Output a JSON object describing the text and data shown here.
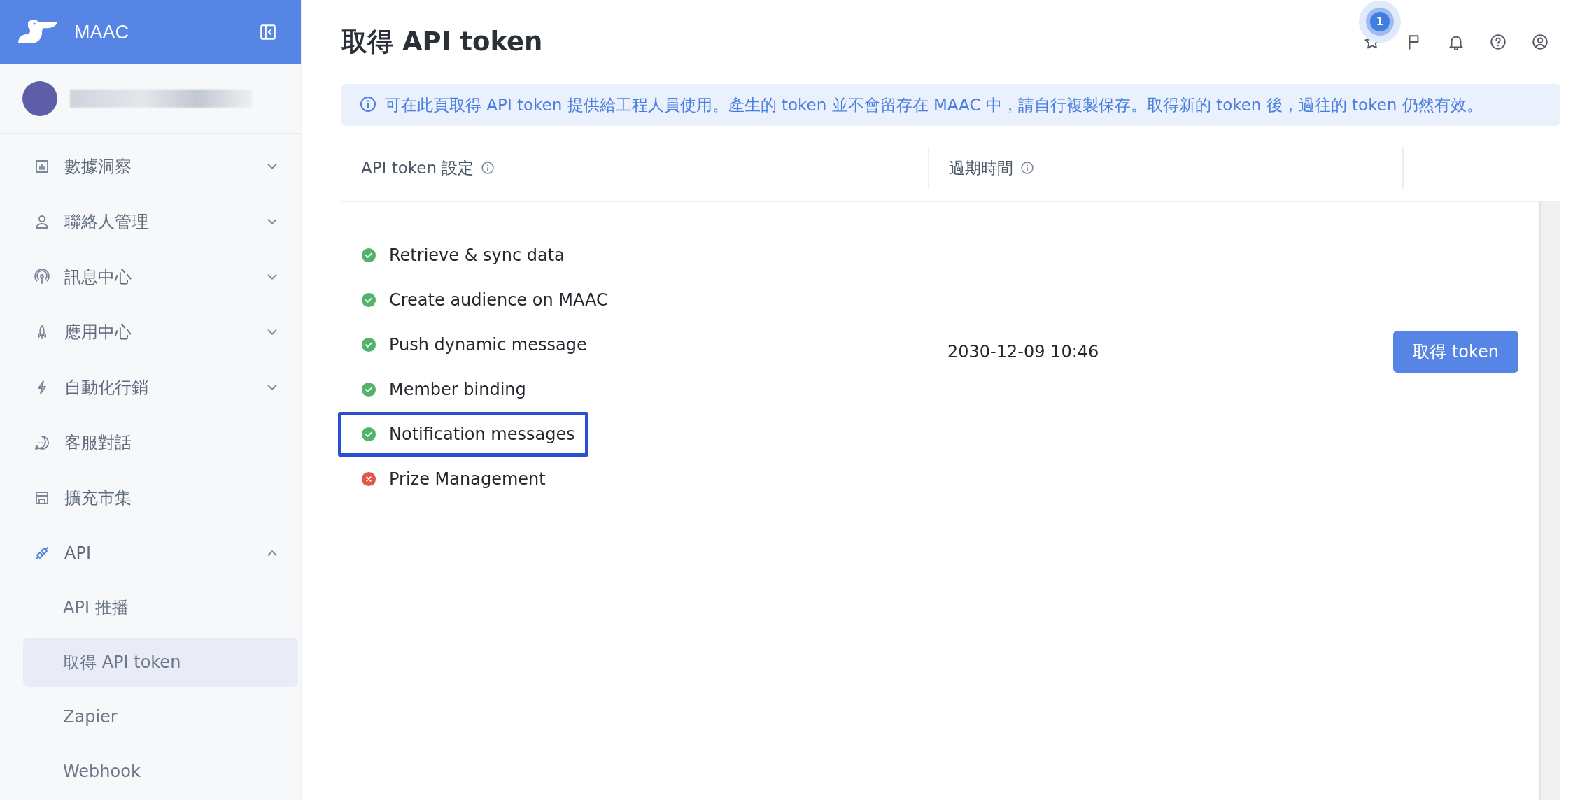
{
  "brand": {
    "name": "MAAC"
  },
  "sidebar": {
    "items": [
      {
        "label": "數據洞察",
        "expanded": false,
        "selected": false
      },
      {
        "label": "聯絡人管理",
        "expanded": false,
        "selected": false
      },
      {
        "label": "訊息中心",
        "expanded": false,
        "selected": false
      },
      {
        "label": "應用中心",
        "expanded": false,
        "selected": false
      },
      {
        "label": "自動化行銷",
        "expanded": false,
        "selected": false
      },
      {
        "label": "客服對話",
        "selected": false
      },
      {
        "label": "擴充市集",
        "selected": false
      },
      {
        "label": "API",
        "expanded": true,
        "selected": true,
        "children": [
          {
            "label": "API 推播",
            "selected": false
          },
          {
            "label": "取得 API token",
            "selected": true
          },
          {
            "label": "Zapier",
            "selected": false
          },
          {
            "label": "Webhook",
            "selected": false
          }
        ]
      }
    ]
  },
  "topbar": {
    "notification_count": "1"
  },
  "page": {
    "title": "取得 API token",
    "notice": "可在此頁取得 API token 提供給工程人員使用。產生的 token 並不會留存在 MAAC 中，請自行複製保存。取得新的 token 後，過往的 token 仍然有效。",
    "table": {
      "columns": [
        "API token 設定",
        "過期時間"
      ],
      "rows": [
        {
          "permissions": [
            {
              "label": "Retrieve & sync data",
              "granted": true,
              "highlighted": false
            },
            {
              "label": "Create audience on MAAC",
              "granted": true,
              "highlighted": false
            },
            {
              "label": "Push dynamic message",
              "granted": true,
              "highlighted": false
            },
            {
              "label": "Member binding",
              "granted": true,
              "highlighted": false
            },
            {
              "label": "Notification messages",
              "granted": true,
              "highlighted": true
            },
            {
              "label": "Prize Management",
              "granted": false,
              "highlighted": false
            }
          ],
          "expires": "2030-12-09 10:46",
          "action": "取得 token"
        }
      ]
    }
  }
}
